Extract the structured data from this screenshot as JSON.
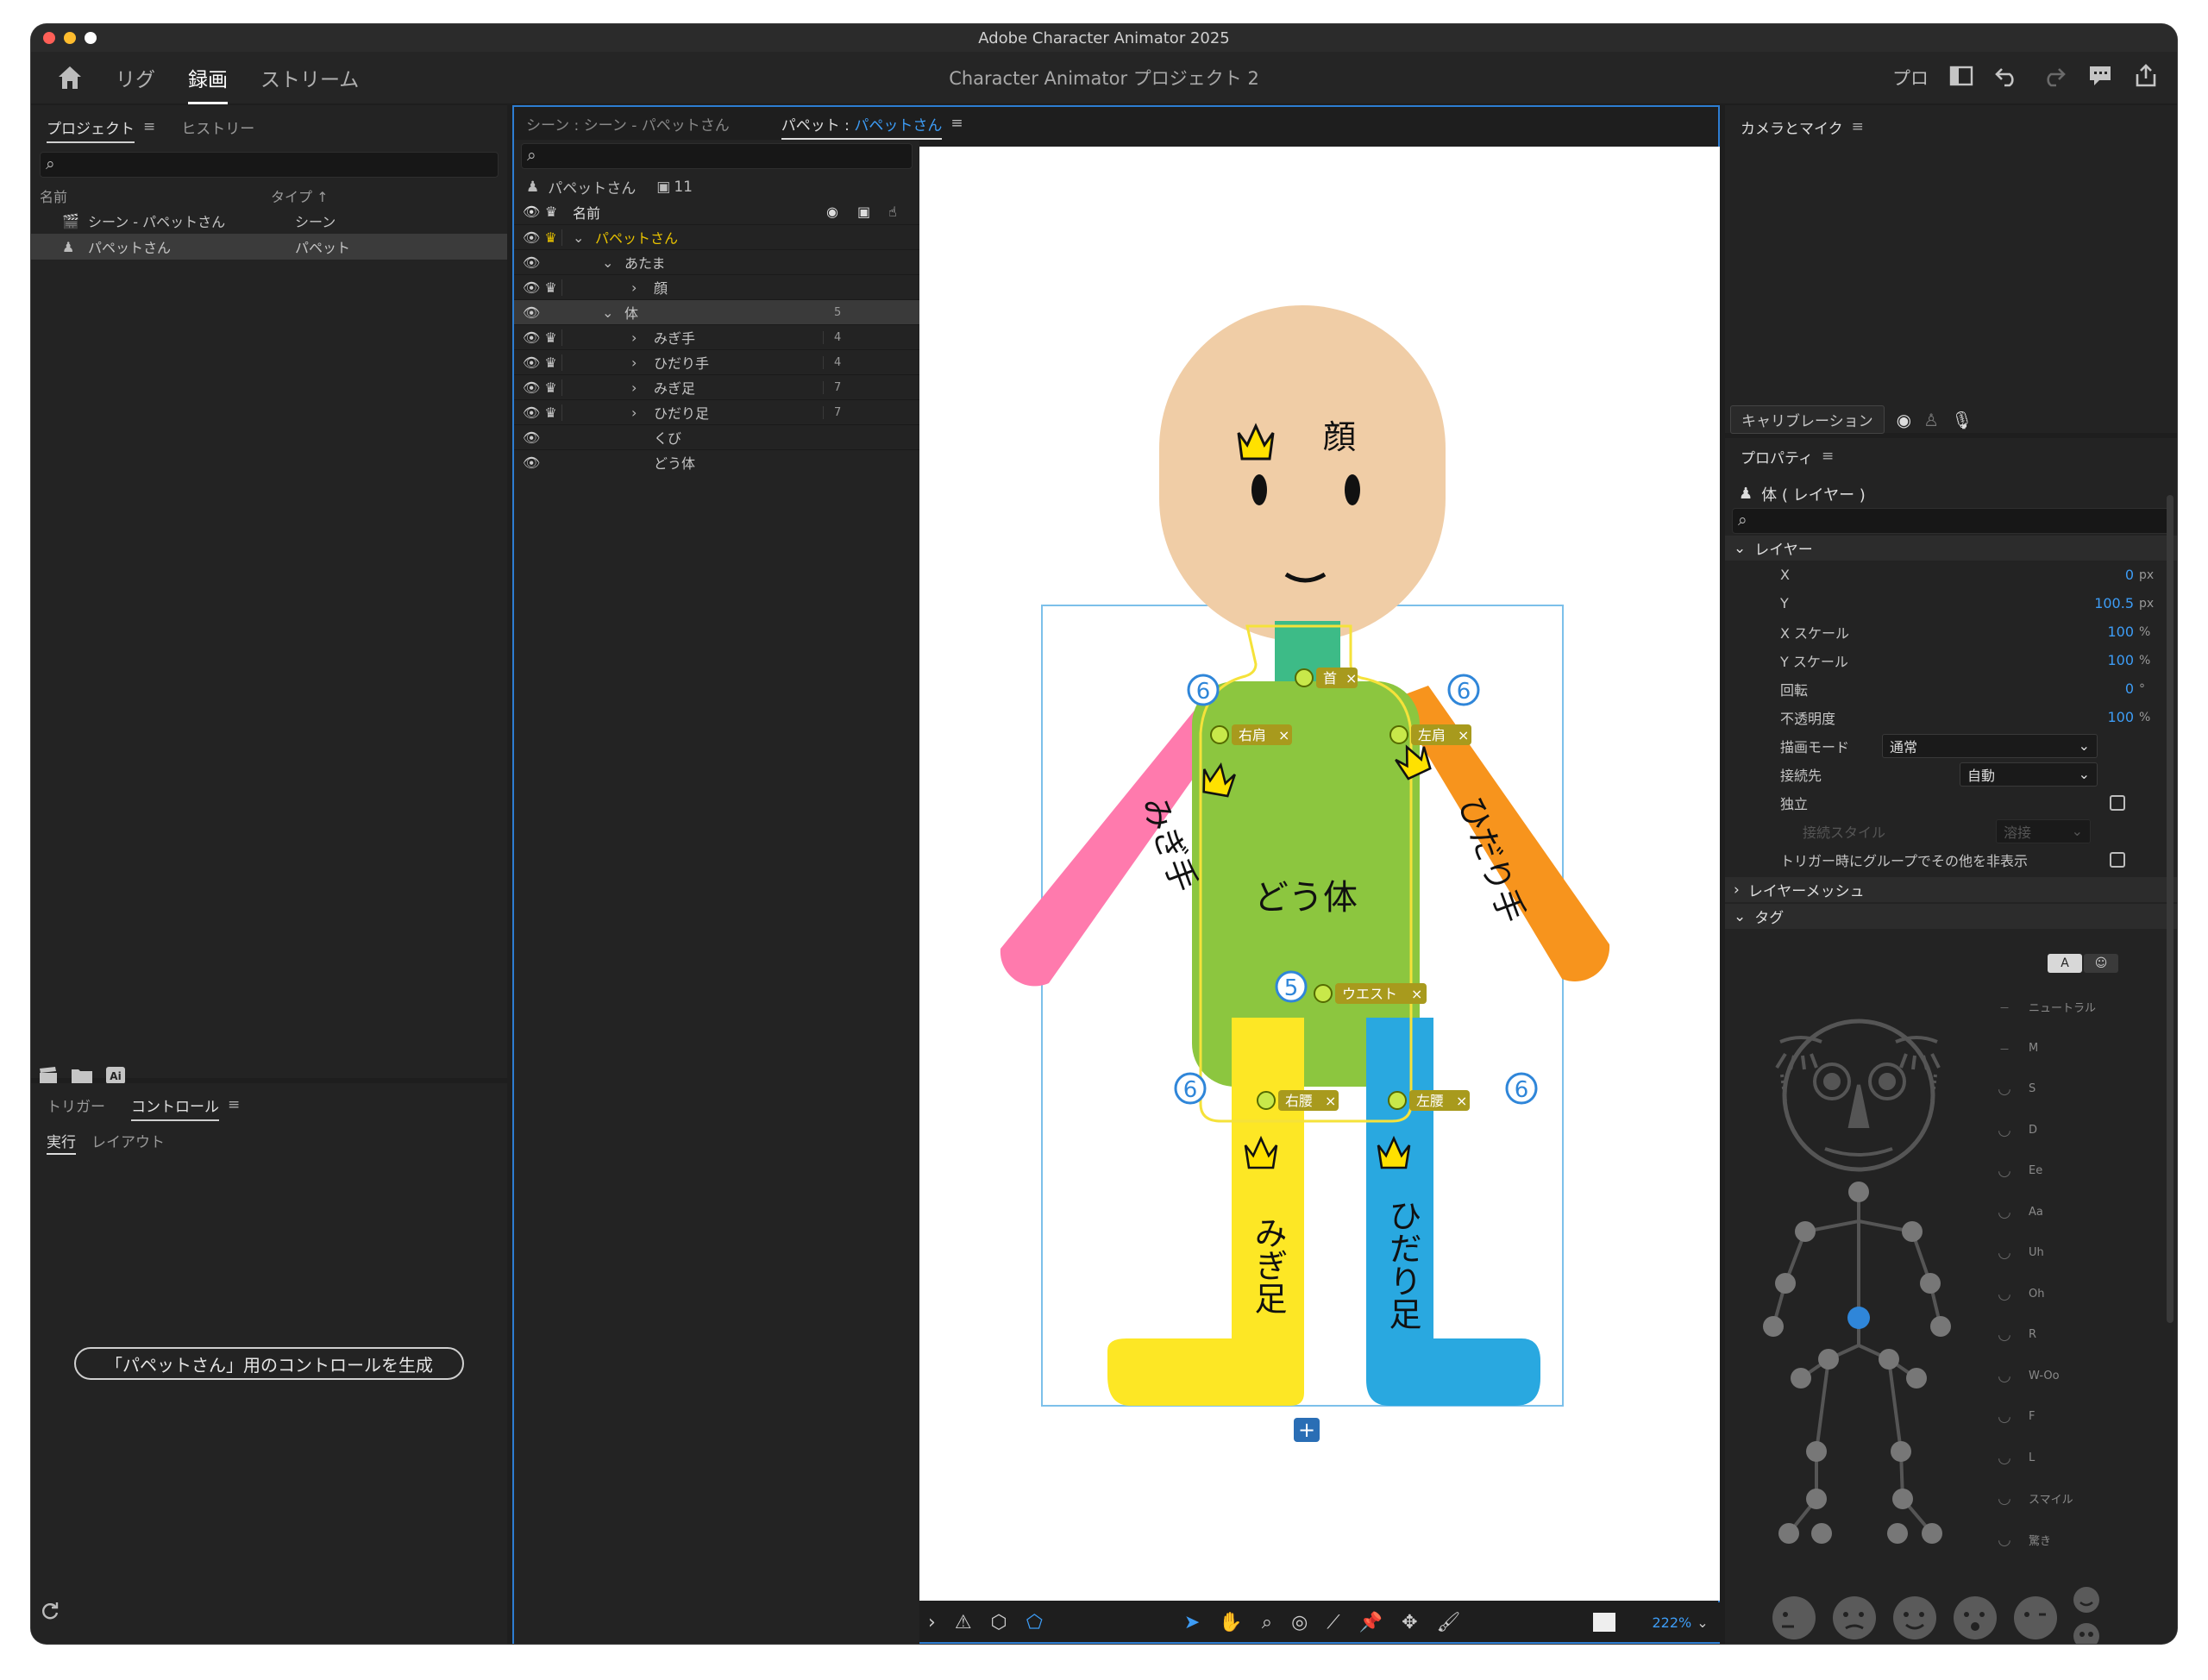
{
  "window": {
    "app_title": "Adobe Character Animator 2025",
    "project_title": "Character Animator プロジェクト 2"
  },
  "workspace_tabs": [
    {
      "label": "リグ",
      "active": false
    },
    {
      "label": "録画",
      "active": true
    },
    {
      "label": "ストリーム",
      "active": false
    }
  ],
  "toolbar_right": {
    "label": "プロ"
  },
  "project_panel": {
    "tabs": [
      {
        "label": "プロジェクト",
        "active": true
      },
      {
        "label": "ヒストリー",
        "active": false
      }
    ],
    "columns": {
      "name": "名前",
      "type": "タイプ"
    },
    "items": [
      {
        "name": "シーン - パペットさん",
        "type": "シーン",
        "icon": "scene-icon",
        "selected": false
      },
      {
        "name": "パペットさん",
        "type": "パペット",
        "icon": "puppet-icon",
        "selected": true
      }
    ]
  },
  "controls_panel": {
    "tabs": [
      {
        "label": "トリガー",
        "active": false
      },
      {
        "label": "コントロール",
        "active": true
      }
    ],
    "subtabs": [
      {
        "label": "実行",
        "active": true
      },
      {
        "label": "レイアウト",
        "active": false
      }
    ],
    "generate_button": "「パペットさん」用のコントロールを生成"
  },
  "center_tabs": {
    "scene_tab": "シーン : シーン - パペットさん",
    "puppet_prefix": "パペット : ",
    "puppet_name": "パペットさん"
  },
  "layer_panel": {
    "puppet_name": "パペットさん",
    "count": "11",
    "header_name": "名前",
    "layers": [
      {
        "label": "パペットさん",
        "indent": 0,
        "chevron": "down",
        "crown": true,
        "crown_yellow": true,
        "count": "",
        "highlight": false
      },
      {
        "label": "あたま",
        "indent": 1,
        "chevron": "down",
        "crown": false,
        "count": "",
        "highlight": false
      },
      {
        "label": "顔",
        "indent": 2,
        "chevron": "right",
        "crown": true,
        "count": "",
        "highlight": false
      },
      {
        "label": "体",
        "indent": 1,
        "chevron": "down",
        "crown": false,
        "count": "5",
        "highlight": true
      },
      {
        "label": "みぎ手",
        "indent": 2,
        "chevron": "right",
        "crown": true,
        "count": "4",
        "highlight": false
      },
      {
        "label": "ひだり手",
        "indent": 2,
        "chevron": "right",
        "crown": true,
        "count": "4",
        "highlight": false
      },
      {
        "label": "みぎ足",
        "indent": 2,
        "chevron": "right",
        "crown": true,
        "count": "7",
        "highlight": false
      },
      {
        "label": "ひだり足",
        "indent": 2,
        "chevron": "right",
        "crown": true,
        "count": "7",
        "highlight": false
      },
      {
        "label": "くび",
        "indent": 2,
        "chevron": "",
        "crown": false,
        "count": "",
        "highlight": false
      },
      {
        "label": "どう体",
        "indent": 2,
        "chevron": "",
        "crown": false,
        "count": "",
        "highlight": false
      }
    ]
  },
  "canvas": {
    "labels": {
      "face": "顔",
      "torso": "どう体",
      "right_arm": "みぎ手",
      "left_arm": "ひだり手",
      "right_leg": "みぎ足",
      "left_leg": "ひだり足"
    },
    "handles": {
      "neck": "首",
      "right_shoulder": "右肩",
      "left_shoulder": "左肩",
      "waist": "ウエスト",
      "right_hip": "右腰",
      "left_hip": "左腰"
    },
    "badges": [
      "6",
      "6",
      "5",
      "6",
      "6"
    ],
    "zoom": "222%",
    "colors": {
      "skin": "#f0cda6",
      "torso": "#8cc63f",
      "right_arm": "#ff7aad",
      "left_arm": "#f7941d",
      "right_leg": "#fde725",
      "left_leg": "#29a8e0"
    }
  },
  "camera_panel": {
    "title": "カメラとマイク",
    "calibration": "キャリブレーション"
  },
  "properties_panel": {
    "title": "プロパティ",
    "layer_title": "体 ( レイヤー )",
    "sections": {
      "layer": "レイヤー",
      "mesh": "レイヤーメッシュ",
      "tags": "タグ"
    },
    "props": [
      {
        "label": "X",
        "value": "0",
        "unit": "px"
      },
      {
        "label": "Y",
        "value": "100.5",
        "unit": "px"
      },
      {
        "label": "X スケール",
        "value": "100",
        "unit": "%"
      },
      {
        "label": "Y スケール",
        "value": "100",
        "unit": "%"
      },
      {
        "label": "回転",
        "value": "0",
        "unit": "°"
      },
      {
        "label": "不透明度",
        "value": "100",
        "unit": "%"
      }
    ],
    "blend_mode": {
      "label": "描画モード",
      "value": "通常"
    },
    "attach_to": {
      "label": "接続先",
      "value": "自動"
    },
    "independent": {
      "label": "独立"
    },
    "attach_style": {
      "label": "接続スタイル",
      "value": "溶接"
    },
    "hide_others": {
      "label": "トリガー時にグループでその他を非表示"
    },
    "tag_toggle": "A",
    "visemes": [
      "ニュートラル",
      "M",
      "S",
      "D",
      "Ee",
      "Aa",
      "Uh",
      "Oh",
      "R",
      "W-Oo",
      "F",
      "L",
      "スマイル",
      "驚き"
    ]
  }
}
